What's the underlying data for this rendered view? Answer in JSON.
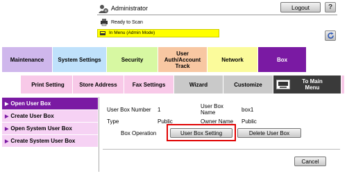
{
  "header": {
    "user": "Administrator",
    "logout_label": "Logout",
    "help_label": "?",
    "status": "Ready to Scan",
    "mode": "In Menu (Admin Mode)"
  },
  "tabs": [
    {
      "label": "Maintenance",
      "bg": "#cfb7ec"
    },
    {
      "label": "System Settings",
      "bg": "#bfe1fb"
    },
    {
      "label": "Security",
      "bg": "#d7f8a2"
    },
    {
      "label": "User Auth/Account Track",
      "bg": "#f8c7a2"
    },
    {
      "label": "Network",
      "bg": "#fbfb9b"
    },
    {
      "label": "Box",
      "bg": "#7a1aa3"
    }
  ],
  "subtabs": [
    {
      "label": "Print Setting"
    },
    {
      "label": "Store Address"
    },
    {
      "label": "Fax Settings"
    },
    {
      "label": "Wizard"
    },
    {
      "label": "Customize"
    },
    {
      "label": "To Main Menu"
    }
  ],
  "menu": [
    {
      "label": "Open User Box",
      "active": true
    },
    {
      "label": "Create User Box",
      "active": false
    },
    {
      "label": "Open System User Box",
      "active": false
    },
    {
      "label": "Create System User Box",
      "active": false
    }
  ],
  "details": {
    "box_number_label": "User Box Number",
    "box_number_value": "1",
    "box_name_label": "User Box Name",
    "box_name_value": "box1",
    "type_label": "Type",
    "type_value": "Public",
    "owner_label": "Owner Name",
    "owner_value": "Public",
    "operation_label": "Box Operation",
    "setting_button": "User Box Setting",
    "delete_button": "Delete User Box",
    "cancel_button": "Cancel"
  }
}
